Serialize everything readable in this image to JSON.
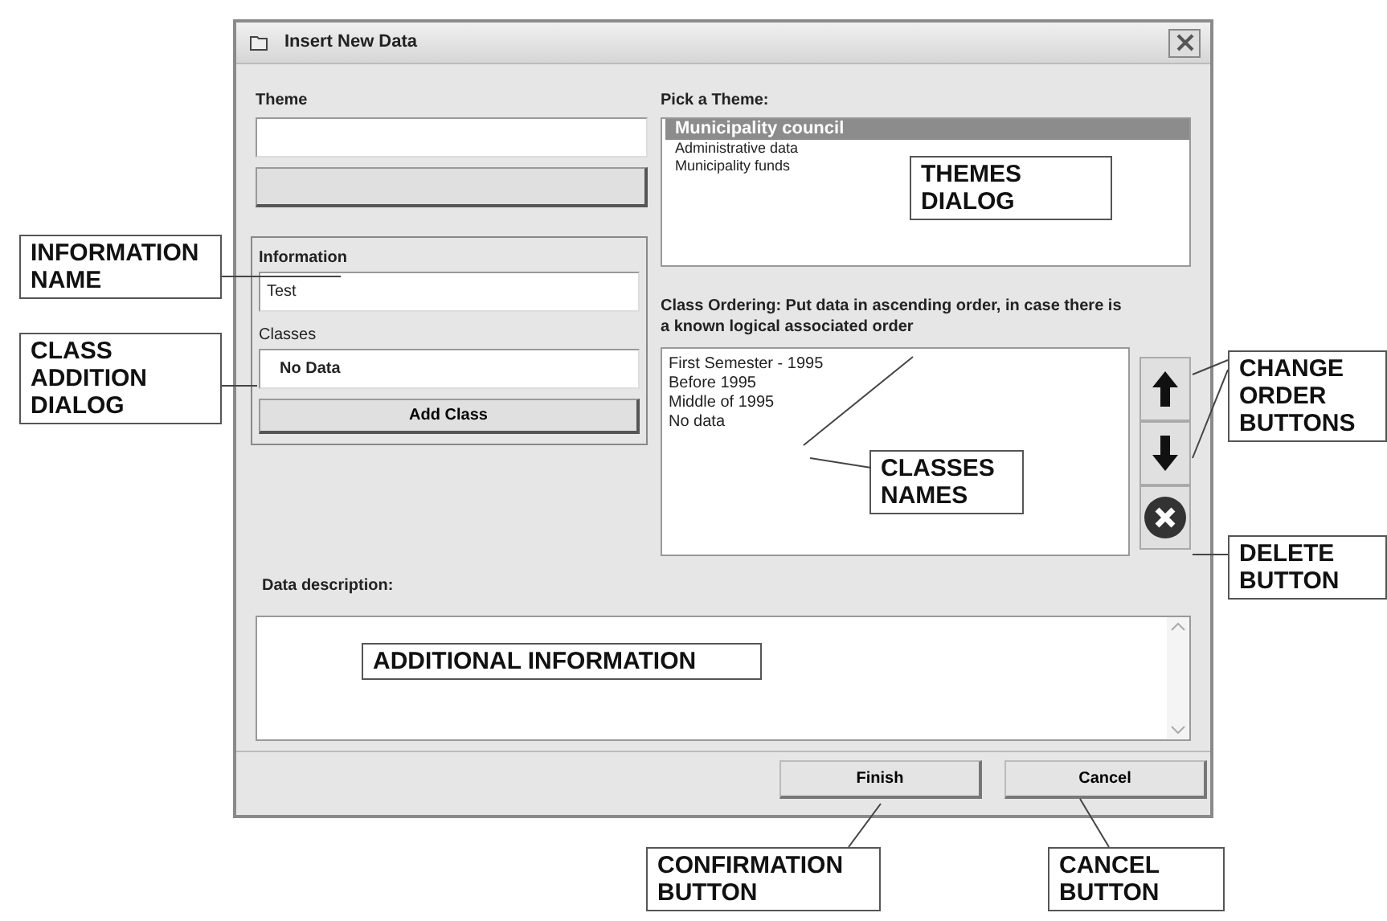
{
  "window": {
    "title": "Insert New Data"
  },
  "theme": {
    "label": "Theme"
  },
  "information_group": {
    "information_label": "Information",
    "information_value": "Test",
    "classes_label": "Classes",
    "classes_value": "No Data",
    "add_button": "Add Class"
  },
  "pick_theme": {
    "label": "Pick a Theme:",
    "items": [
      {
        "label": "Municipality council",
        "selected": true
      },
      {
        "label": "Administrative data",
        "selected": false
      },
      {
        "label": "Municipality funds",
        "selected": false
      }
    ]
  },
  "class_ordering": {
    "label": "Class Ordering: Put data in ascending order, in case there is a known logical associated order",
    "items": [
      "First Semester - 1995",
      "Before 1995",
      "Middle of 1995",
      "No data"
    ]
  },
  "description": {
    "label": "Data description:"
  },
  "buttons": [
    "Finish",
    "Cancel"
  ],
  "annotations": [
    "INFORMATION\nNAME",
    "CLASS\nADDITION\nDIALOG",
    "THEMES\nDIALOG",
    "CHANGE\nORDER\nBUTTONS",
    "CLASSES\nNAMES",
    "DELETE\nBUTTON",
    "ADDITIONAL INFORMATION",
    "CONFIRMATION\nBUTTON",
    "CANCEL\nBUTTON"
  ]
}
